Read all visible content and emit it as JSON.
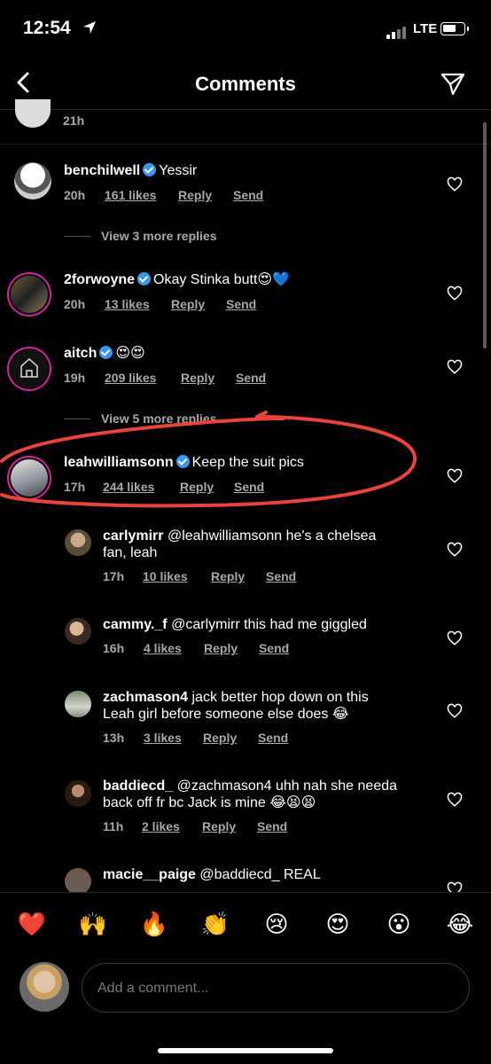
{
  "status_bar": {
    "time": "12:54",
    "network": "LTE"
  },
  "header": {
    "title": "Comments"
  },
  "partial_comment": {
    "time": "21h"
  },
  "comments": [
    {
      "user": "benchilwell",
      "verified": true,
      "text": "Yessir",
      "time": "20h",
      "likes": "161 likes",
      "reply": "Reply",
      "send": "Send",
      "view_more": "View 3 more replies"
    },
    {
      "user": "2forwoyne",
      "verified": true,
      "text": "Okay Stinka butt😍💙",
      "time": "20h",
      "likes": "13 likes",
      "reply": "Reply",
      "send": "Send"
    },
    {
      "user": "aitch",
      "verified": true,
      "text": "😍😍",
      "time": "19h",
      "likes": "209 likes",
      "reply": "Reply",
      "send": "Send",
      "view_more": "View 5 more replies"
    },
    {
      "user": "leahwilliamsonn",
      "verified": true,
      "text": "Keep the suit pics",
      "time": "17h",
      "likes": "244 likes",
      "reply": "Reply",
      "send": "Send"
    }
  ],
  "replies": [
    {
      "user": "carlymirr",
      "text_line1": "@leahwilliamsonn he's a chelsea",
      "text_line2": "fan, leah",
      "time": "17h",
      "likes": "10 likes",
      "reply": "Reply",
      "send": "Send"
    },
    {
      "user": "cammy._f",
      "text_line1": "@carlymirr this had me giggled",
      "time": "16h",
      "likes": "4 likes",
      "reply": "Reply",
      "send": "Send"
    },
    {
      "user": "zachmason4",
      "text_line1": "jack better hop down on this",
      "text_line2": "Leah girl before someone else does 😂",
      "time": "13h",
      "likes": "3 likes",
      "reply": "Reply",
      "send": "Send"
    },
    {
      "user": "baddiecd_",
      "text_line1": "@zachmason4 uhh nah she needa",
      "text_line2": "back off fr bc Jack is mine 😂😫😫",
      "time": "11h",
      "likes": "2 likes",
      "reply": "Reply",
      "send": "Send"
    },
    {
      "user": "macie__paige",
      "text_line1": "@baddiecd_ REAL"
    }
  ],
  "reactions": [
    "❤️",
    "🙌",
    "🔥",
    "👏",
    "😢",
    "😍",
    "😮",
    "😂"
  ],
  "composer": {
    "placeholder": "Add a comment..."
  },
  "colors": {
    "annotation": "#e8443a",
    "verified": "#3897f0",
    "story_ring": "#d6249f"
  }
}
